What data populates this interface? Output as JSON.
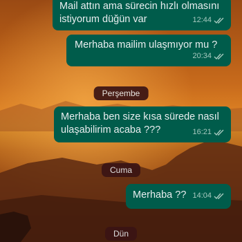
{
  "messages": [
    {
      "text": "Mail attın ama sürecin hızlı olmasını istiyorum  düğün var",
      "time": "12:44",
      "status": "read-icon"
    },
    {
      "text": "Merhaba mailim ulaşmıyor mu ?",
      "time": "20:34",
      "status": "read-icon"
    },
    {
      "text": "Merhaba ben size kısa sürede nasıl ulaşabilirim acaba ???",
      "time": "16:21",
      "status": "read-icon"
    },
    {
      "text": "Merhaba ??",
      "time": "14:04",
      "status": "read-icon"
    }
  ],
  "date_separators": [
    "Perşembe",
    "Cuma",
    "Dün"
  ],
  "colors": {
    "outgoing_bubble": "#005c4b",
    "message_text": "#e9edef",
    "meta_text": "#a6c9bf",
    "date_chip": "#3b1414"
  }
}
